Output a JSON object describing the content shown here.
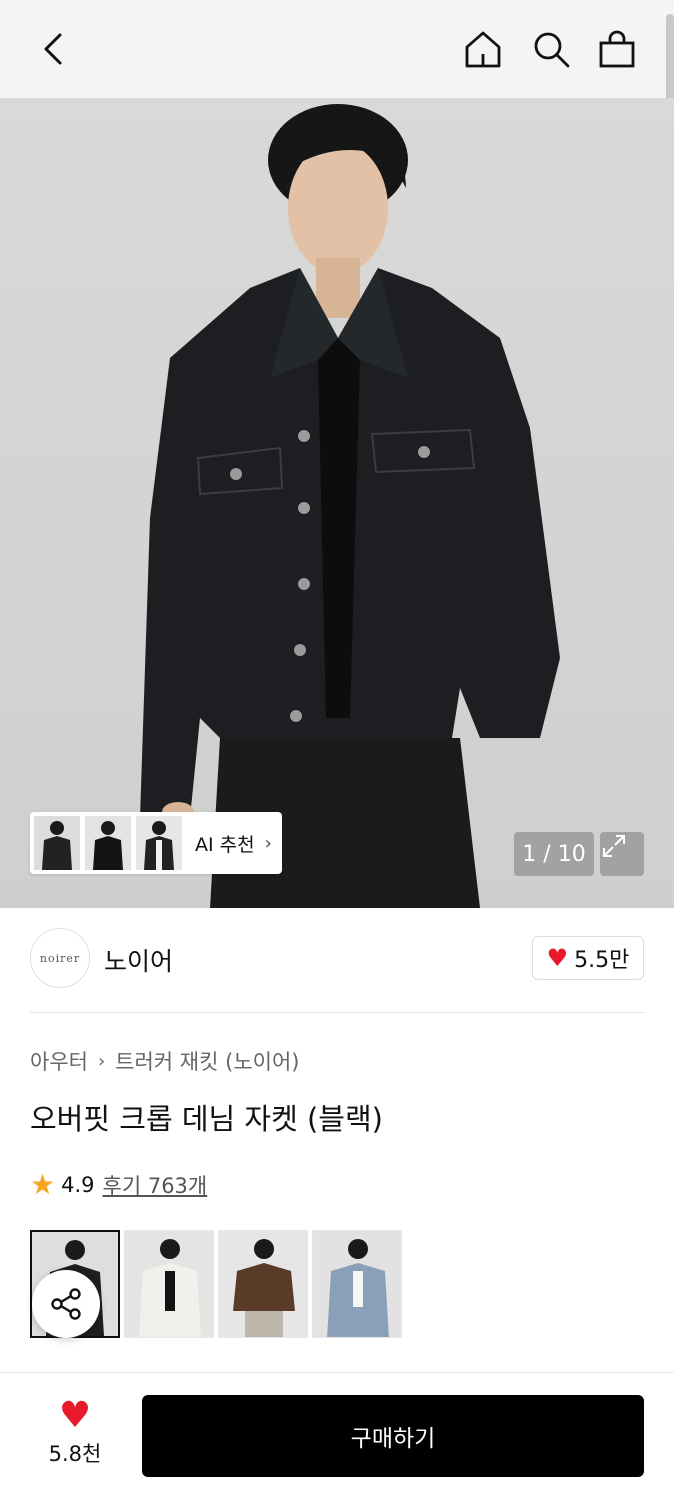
{
  "header": {
    "back_icon": "chevron-left-icon",
    "home_icon": "home-icon",
    "search_icon": "search-icon",
    "bag_icon": "shopping-bag-icon"
  },
  "gallery": {
    "counter": "1 / 10",
    "ai_recommend_label": "AI 추천",
    "expand_icon": "expand-icon"
  },
  "brand": {
    "logo_text": "noirer",
    "name": "노이어",
    "like_count": "5.5만"
  },
  "product": {
    "breadcrumb": [
      "아우터",
      "트러커 재킷 (노이어)"
    ],
    "title": "오버핏 크롭 데님 자켓 (블랙)",
    "rating": "4.9",
    "review_link": "후기 763개"
  },
  "variants": [
    "black",
    "white",
    "brown",
    "light-blue"
  ],
  "bottom_bar": {
    "like_count": "5.8천",
    "buy_label": "구매하기"
  },
  "colors": {
    "heart": "#e8192b",
    "star": "#f5a623",
    "buy_button": "#000000"
  }
}
